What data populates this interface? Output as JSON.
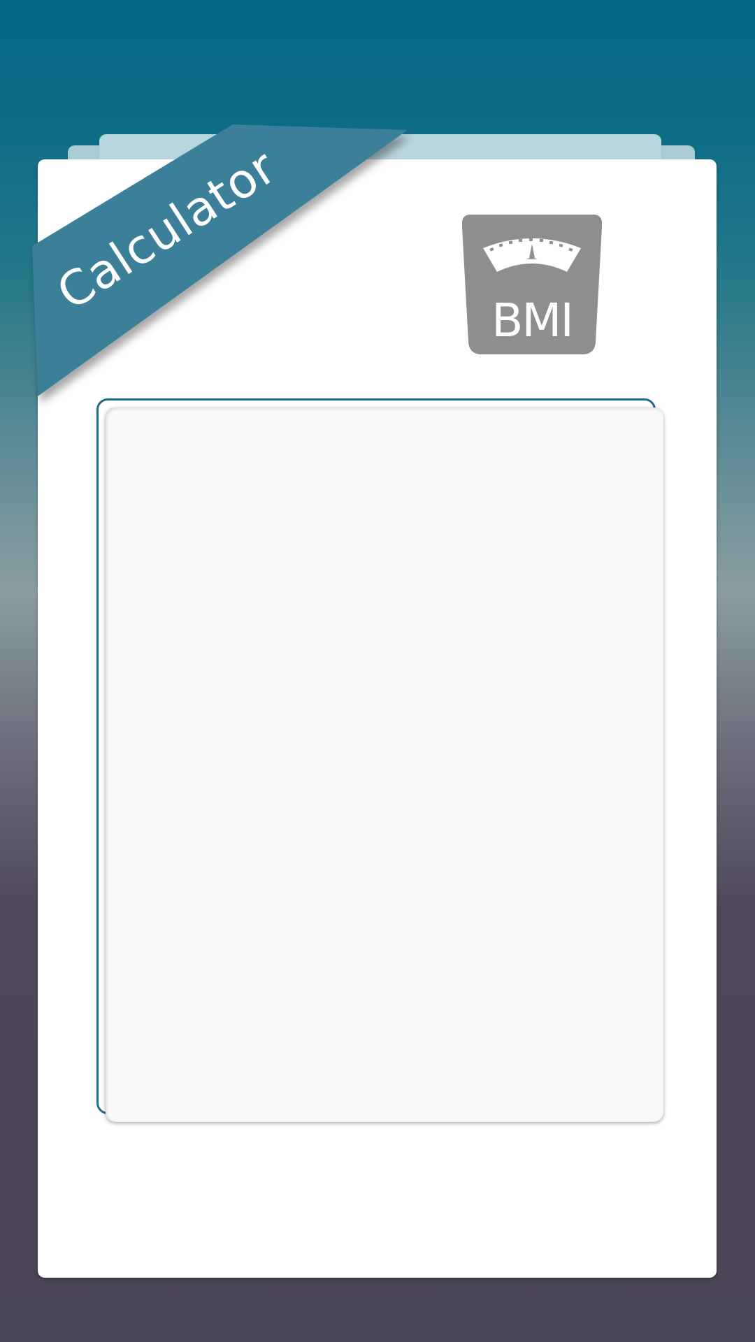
{
  "app": {
    "ribbon_label": "Calculator",
    "logo_text": "BMI",
    "logo_icon": "scale-icon"
  },
  "colors": {
    "accent": "#1f6e85",
    "ribbon": "#3b7f98",
    "logo_bg": "#8e8e8e"
  },
  "result_panel": {
    "content": ""
  }
}
